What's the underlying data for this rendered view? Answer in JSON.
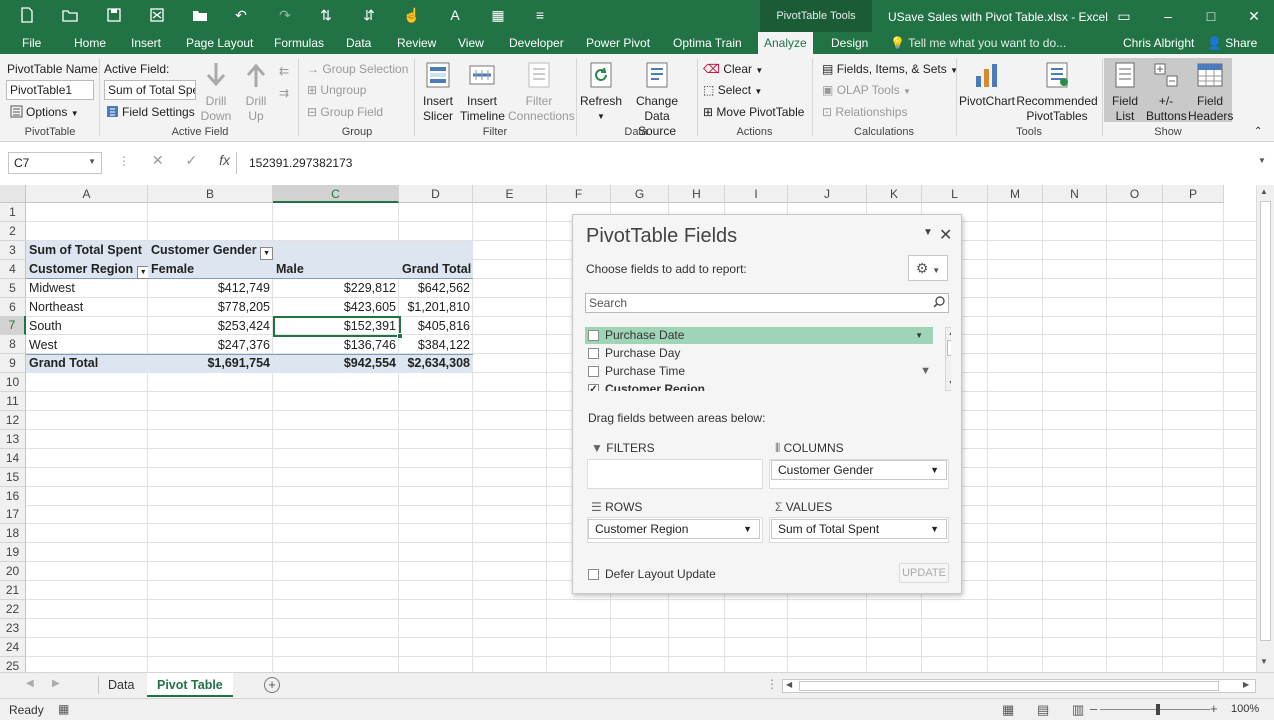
{
  "titlebar": {
    "context_tools": "PivotTable Tools",
    "doc_title": "USave Sales with Pivot Table.xlsx - Excel",
    "accent": "#217346"
  },
  "tabs": [
    {
      "label": "File"
    },
    {
      "label": "Home"
    },
    {
      "label": "Insert"
    },
    {
      "label": "Page Layout"
    },
    {
      "label": "Formulas"
    },
    {
      "label": "Data"
    },
    {
      "label": "Review"
    },
    {
      "label": "View"
    },
    {
      "label": "Developer"
    },
    {
      "label": "Power Pivot"
    },
    {
      "label": "Optima Train"
    },
    {
      "label": "Analyze"
    },
    {
      "label": "Design"
    }
  ],
  "tellme": "Tell me what you want to do...",
  "user": "Chris Albright",
  "share": "Share",
  "ribbon": {
    "pivottable": {
      "name_label": "PivotTable Name:",
      "name_value": "PivotTable1",
      "options": "Options",
      "group": "PivotTable"
    },
    "active_field": {
      "label": "Active Field:",
      "value": "Sum of Total Sper",
      "field_settings": "Field Settings",
      "drill_down_1": "Drill",
      "drill_down_2": "Down",
      "drill_up_1": "Drill",
      "drill_up_2": "Up",
      "group": "Active Field"
    },
    "group_group": {
      "group_selection": "Group Selection",
      "ungroup": "Ungroup",
      "group_field": "Group Field",
      "group": "Group"
    },
    "filter": {
      "insert_slicer_1": "Insert",
      "insert_slicer_2": "Slicer",
      "insert_timeline_1": "Insert",
      "insert_timeline_2": "Timeline",
      "filter_conn_1": "Filter",
      "filter_conn_2": "Connections",
      "group": "Filter"
    },
    "data": {
      "refresh": "Refresh",
      "change_source_1": "Change Data",
      "change_source_2": "Source",
      "group": "Data"
    },
    "actions": {
      "clear": "Clear",
      "select": "Select",
      "move": "Move PivotTable",
      "group": "Actions"
    },
    "calculations": {
      "fields_items_sets": "Fields, Items, & Sets",
      "olap_tools": "OLAP Tools",
      "relationships": "Relationships",
      "group": "Calculations"
    },
    "tools": {
      "pivotchart": "PivotChart",
      "recommended_1": "Recommended",
      "recommended_2": "PivotTables",
      "group": "Tools"
    },
    "show": {
      "field_list_1": "Field",
      "field_list_2": "List",
      "buttons_1": "+/-",
      "buttons_2": "Buttons",
      "headers_1": "Field",
      "headers_2": "Headers",
      "group": "Show"
    }
  },
  "formula_bar": {
    "name_box": "C7",
    "fx": "fx",
    "value": "152391.297382173"
  },
  "sheet": {
    "columns": [
      "A",
      "B",
      "C",
      "D",
      "E",
      "F",
      "G",
      "H",
      "I",
      "J",
      "K",
      "L",
      "M",
      "N",
      "O",
      "P"
    ],
    "rows": [
      "1",
      "2",
      "3",
      "4",
      "5",
      "6",
      "7",
      "8",
      "9",
      "10",
      "11",
      "12",
      "13",
      "14",
      "15",
      "16",
      "17",
      "18",
      "19",
      "20",
      "21",
      "22",
      "23",
      "24",
      "25"
    ],
    "pivot": {
      "values_label": "Sum of Total Spent",
      "col_field": "Customer Gender",
      "row_field": "Customer Region",
      "headers": [
        "Female",
        "Male",
        "Grand Total"
      ],
      "rows": [
        {
          "region": "Midwest",
          "female": "$412,749",
          "male": "$229,812",
          "total": "$642,562"
        },
        {
          "region": "Northeast",
          "female": "$778,205",
          "male": "$423,605",
          "total": "$1,201,810"
        },
        {
          "region": "South",
          "female": "$253,424",
          "male": "$152,391",
          "total": "$405,816"
        },
        {
          "region": "West",
          "female": "$247,376",
          "male": "$136,746",
          "total": "$384,122"
        }
      ],
      "grand": {
        "label": "Grand Total",
        "female": "$1,691,754",
        "male": "$942,554",
        "total": "$2,634,308"
      }
    }
  },
  "pivot_panel": {
    "title": "PivotTable Fields",
    "choose": "Choose fields to add to report:",
    "search_placeholder": "Search",
    "fields": [
      {
        "label": "Purchase Date",
        "checked": false
      },
      {
        "label": "Purchase Day",
        "checked": false
      },
      {
        "label": "Purchase Time",
        "checked": false
      },
      {
        "label": "Customer Region",
        "checked": true
      }
    ],
    "drag_hint": "Drag fields between areas below:",
    "filters": "FILTERS",
    "columns": "COLUMNS",
    "rows": "ROWS",
    "values": "VALUES",
    "columns_item": "Customer Gender",
    "rows_item": "Customer Region",
    "values_item": "Sum of Total Spent",
    "defer": "Defer Layout Update",
    "update": "UPDATE"
  },
  "sheet_tabs": [
    {
      "label": "Data"
    },
    {
      "label": "Pivot Table"
    }
  ],
  "status": {
    "ready": "Ready",
    "zoom": "100%"
  }
}
